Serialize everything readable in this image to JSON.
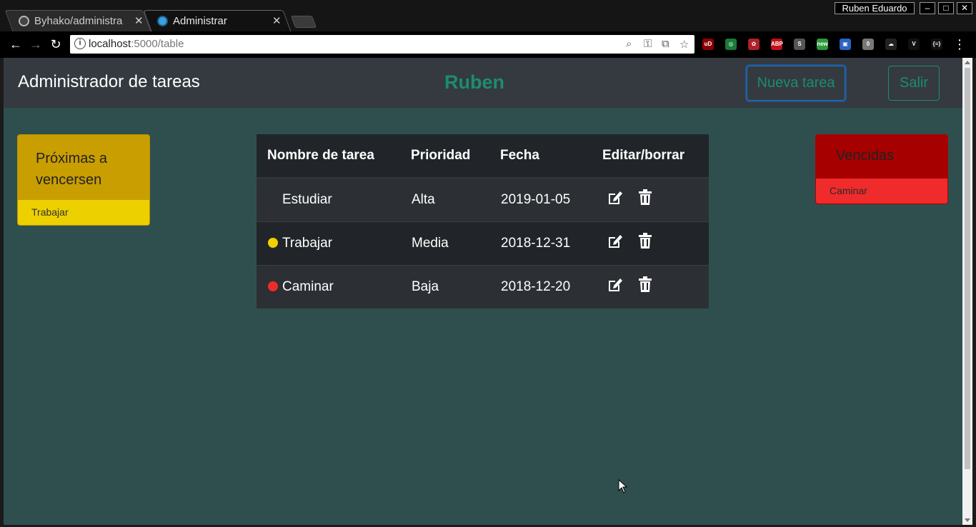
{
  "browser": {
    "tabs": [
      {
        "title": "Byhako/administra",
        "close": "✕"
      },
      {
        "title": "Administrar",
        "close": "✕"
      }
    ],
    "profile_name": "Ruben Eduardo",
    "window_controls": {
      "minimize": "–",
      "maximize": "□",
      "close": "✕"
    },
    "nav": {
      "back": "←",
      "forward": "→",
      "reload": "↻"
    },
    "url_host": "localhost",
    "url_rest": ":5000/table",
    "extensions": [
      {
        "name": "ublock-origin-icon",
        "label": "uD",
        "color": "#8b0000"
      },
      {
        "name": "target-extension-icon",
        "label": "◎",
        "color": "#1a7a3a"
      },
      {
        "name": "puzzle-extension-icon",
        "label": "✿",
        "color": "#b0202a"
      },
      {
        "name": "adblock-plus-icon",
        "label": "ABP",
        "color": "#c0101a"
      },
      {
        "name": "s-extension-icon",
        "label": "S",
        "color": "#555555"
      },
      {
        "name": "new-extension-icon",
        "label": "new",
        "color": "#2d9a3c"
      },
      {
        "name": "book-extension-icon",
        "label": "▣",
        "color": "#2b63c2"
      },
      {
        "name": "zero-extension-icon",
        "label": "0",
        "color": "#777777"
      },
      {
        "name": "cloud-extension-icon",
        "label": "☁",
        "color": "#222222"
      },
      {
        "name": "vue-devtools-icon",
        "label": "V",
        "color": "#111111"
      },
      {
        "name": "json-extension-icon",
        "label": "{≡}",
        "color": "#111111"
      }
    ],
    "menu": "⋮"
  },
  "app": {
    "brand": "Administrador de tareas",
    "username": "Ruben",
    "new_task_button": "Nueva tarea",
    "exit_button": "Salir"
  },
  "upcoming": {
    "title": "Próximas a vencersen",
    "items": [
      "Trabajar"
    ]
  },
  "overdue": {
    "title": "Vencidas",
    "items": [
      "Caminar"
    ]
  },
  "table": {
    "headers": [
      "Nombre de tarea",
      "Prioridad",
      "Fecha",
      "Editar/borrar"
    ],
    "rows": [
      {
        "name": "Estudiar",
        "priority": "Alta",
        "date": "2019-01-05",
        "status_color": ""
      },
      {
        "name": "Trabajar",
        "priority": "Media",
        "date": "2018-12-31",
        "status_color": "#f2d000"
      },
      {
        "name": "Caminar",
        "priority": "Baja",
        "date": "2018-12-20",
        "status_color": "#ee2b2b"
      }
    ]
  },
  "colors": {
    "page_bg": "#2f4f4f",
    "navbar_bg": "#343a40",
    "accent": "#1d8c6e",
    "warning": "#c99e00",
    "danger": "#a60000"
  }
}
